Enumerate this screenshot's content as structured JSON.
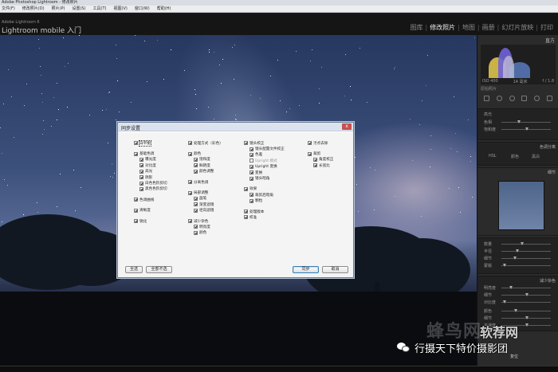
{
  "window": {
    "title": "Adobe Photoshop Lightroom - 修改照片"
  },
  "menubar": {
    "items": [
      "文件(F)",
      "修改照片(D)",
      "照片(P)",
      "设置(S)",
      "工具(T)",
      "视图(V)",
      "窗口(W)",
      "帮助(H)"
    ]
  },
  "header": {
    "version": "Adobe Lightroom 6",
    "brand": "Lightroom mobile 入门",
    "modules": [
      {
        "label": "图库",
        "active": false
      },
      {
        "label": "修改照片",
        "active": true
      },
      {
        "label": "地图",
        "active": false
      },
      {
        "label": "画册",
        "active": false
      },
      {
        "label": "幻灯片放映",
        "active": false
      },
      {
        "label": "打印",
        "active": false
      }
    ]
  },
  "right_panel": {
    "title": "直方",
    "histogram_readout": [
      "ISO 400",
      "14 毫米",
      "f / 1.8"
    ],
    "original_photo_label": "原始照片",
    "split_toning": {
      "title": "色调分离",
      "highlights_title": "高光",
      "labels": [
        "色相",
        "饱和度"
      ]
    },
    "hsl": {
      "tabs": [
        "HSL",
        "颜色",
        "黑白"
      ]
    },
    "detail": {
      "title": "细节",
      "labels": [
        "数量",
        "半径",
        "细节",
        "蒙版"
      ]
    },
    "noise": {
      "title": "减少杂色",
      "labels": [
        "明亮度",
        "细节",
        "对比度",
        "颜色",
        "细节",
        "平滑度"
      ]
    },
    "buttons": {
      "copy": "上一张",
      "reset": "复位"
    }
  },
  "dialog": {
    "title": "同步设置",
    "close_glyph": "x",
    "columns": [
      [
        {
          "label": "白平衡",
          "checked": true,
          "level": 0,
          "focus": true
        },
        {
          "gap": true
        },
        {
          "label": "基础色调",
          "checked": true,
          "level": 0
        },
        {
          "label": "曝光度",
          "checked": true,
          "level": 1
        },
        {
          "label": "对比度",
          "checked": true,
          "level": 1
        },
        {
          "label": "高光",
          "checked": true,
          "level": 1
        },
        {
          "label": "阴影",
          "checked": true,
          "level": 1
        },
        {
          "label": "白色色阶剪切",
          "checked": true,
          "level": 1
        },
        {
          "label": "黑色色阶剪切",
          "checked": true,
          "level": 1
        },
        {
          "gap": true
        },
        {
          "label": "色调曲线",
          "checked": true,
          "level": 0
        },
        {
          "gap": true
        },
        {
          "label": "清晰度",
          "checked": true,
          "level": 0
        },
        {
          "gap": true
        },
        {
          "label": "锐化",
          "checked": true,
          "level": 0
        }
      ],
      [
        {
          "label": "处理方式（彩色）",
          "checked": true,
          "level": 0
        },
        {
          "gap": true
        },
        {
          "label": "颜色",
          "checked": true,
          "level": 0
        },
        {
          "label": "饱和度",
          "checked": true,
          "level": 1
        },
        {
          "label": "鲜艳度",
          "checked": true,
          "level": 1
        },
        {
          "label": "颜色调整",
          "checked": true,
          "level": 1
        },
        {
          "gap": true
        },
        {
          "label": "分离色调",
          "checked": true,
          "level": 0
        },
        {
          "gap": true
        },
        {
          "label": "局部调整",
          "checked": true,
          "level": 0
        },
        {
          "label": "画笔",
          "checked": true,
          "level": 1
        },
        {
          "label": "渐变滤镜",
          "checked": true,
          "level": 1
        },
        {
          "label": "径向滤镜",
          "checked": true,
          "level": 1
        },
        {
          "gap": true
        },
        {
          "label": "减少杂色",
          "checked": true,
          "level": 0
        },
        {
          "label": "明亮度",
          "checked": true,
          "level": 1
        },
        {
          "label": "颜色",
          "checked": true,
          "level": 1
        }
      ],
      [
        {
          "label": "镜头校正",
          "checked": true,
          "level": 0
        },
        {
          "label": "镜头配置文件校正",
          "checked": true,
          "level": 1
        },
        {
          "label": "色差",
          "checked": true,
          "level": 1
        },
        {
          "label": "Upright 模式",
          "checked": false,
          "level": 1,
          "dim": true
        },
        {
          "label": "Upright 变换",
          "checked": true,
          "level": 1
        },
        {
          "label": "变换",
          "checked": true,
          "level": 1
        },
        {
          "label": "镜头暗角",
          "checked": true,
          "level": 1
        },
        {
          "gap": true
        },
        {
          "label": "效果",
          "checked": true,
          "level": 0
        },
        {
          "label": "裁剪后暗角",
          "checked": true,
          "level": 1
        },
        {
          "label": "颗粒",
          "checked": true,
          "level": 1
        },
        {
          "gap": true
        },
        {
          "label": "处理版本",
          "checked": true,
          "level": 0
        },
        {
          "label": "校准",
          "checked": true,
          "level": 0
        }
      ],
      [
        {
          "label": "污点去除",
          "checked": true,
          "level": 0
        },
        {
          "gap": true
        },
        {
          "label": "裁剪",
          "checked": true,
          "level": 0
        },
        {
          "label": "角度校正",
          "checked": true,
          "level": 1
        },
        {
          "label": "长宽比",
          "checked": true,
          "level": 1
        }
      ]
    ],
    "buttons": {
      "select_all": "全选",
      "select_none": "全部不选",
      "sync": "同步",
      "cancel": "取消"
    }
  },
  "watermarks": {
    "logo": "蜂鸟网",
    "site": "软荐网",
    "wechat": "行摄天下特价摄影团"
  },
  "colors": {
    "accent": "#3c7fb1",
    "panel_bg": "#2b2b2b",
    "dialog_bg": "#f4f4f4"
  }
}
